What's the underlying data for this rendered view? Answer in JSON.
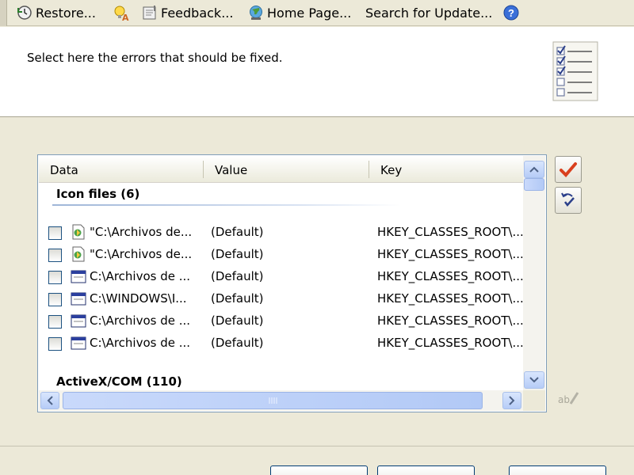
{
  "toolbar": {
    "items": [
      {
        "label": "Restore...",
        "icon": "restore-icon"
      },
      {
        "label": "Feedback...",
        "icon": "feedback-icon"
      },
      {
        "label": "Home Page...",
        "icon": "home-page-icon"
      },
      {
        "label": "Search for Update...",
        "icon": "none"
      }
    ],
    "extra_icons": [
      "tips-icon",
      "help-icon"
    ]
  },
  "header": {
    "instruction": "Select here the errors that should be fixed."
  },
  "list": {
    "columns": [
      "Data",
      "Value",
      "Key"
    ],
    "groups": [
      {
        "title": "Icon files (6)"
      },
      {
        "title": "ActiveX/COM (110)"
      }
    ],
    "rows": [
      {
        "data": "\"C:\\Archivos de...",
        "value": "(Default)",
        "key": "HKEY_CLASSES_ROOT\\...",
        "icon": "script-file-icon"
      },
      {
        "data": "\"C:\\Archivos de...",
        "value": "(Default)",
        "key": "HKEY_CLASSES_ROOT\\...",
        "icon": "script-file-icon"
      },
      {
        "data": "C:\\Archivos de ...",
        "value": "(Default)",
        "key": "HKEY_CLASSES_ROOT\\...",
        "icon": "window-icon"
      },
      {
        "data": "C:\\WINDOWS\\I...",
        "value": "(Default)",
        "key": "HKEY_CLASSES_ROOT\\...",
        "icon": "window-icon"
      },
      {
        "data": "C:\\Archivos de ...",
        "value": "(Default)",
        "key": "HKEY_CLASSES_ROOT\\...",
        "icon": "window-icon"
      },
      {
        "data": "C:\\Archivos de ...",
        "value": "(Default)",
        "key": "HKEY_CLASSES_ROOT\\...",
        "icon": "window-icon"
      }
    ]
  },
  "side_buttons": [
    "check-all-icon",
    "invert-selection-icon",
    "rename-icon"
  ],
  "colors": {
    "window_bg": "#ece9d8",
    "list_border": "#7f9db9",
    "scroll_blue": "#b6ccf7",
    "check_red": "#d9401e"
  }
}
